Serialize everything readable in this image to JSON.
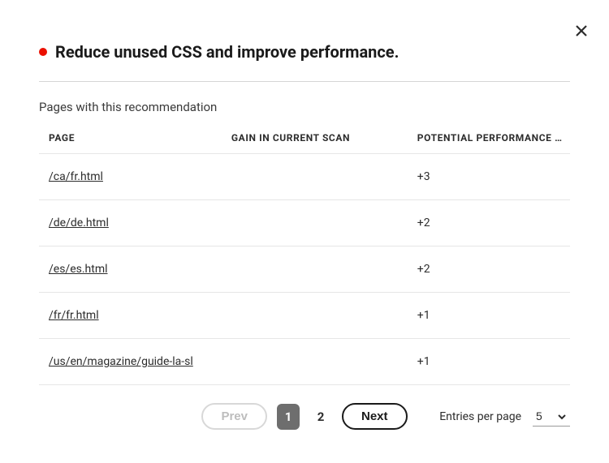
{
  "header": {
    "title": "Reduce unused CSS and improve performance.",
    "status_color": "#eb1000"
  },
  "subtitle": "Pages with this recommendation",
  "table": {
    "headers": {
      "page": "PAGE",
      "gain": "GAIN IN CURRENT SCAN",
      "potential": "POTENTIAL PERFORMANCE …"
    },
    "rows": [
      {
        "page": "/ca/fr.html",
        "gain": "",
        "potential": "+3"
      },
      {
        "page": "/de/de.html",
        "gain": "",
        "potential": "+2"
      },
      {
        "page": "/es/es.html",
        "gain": "",
        "potential": "+2"
      },
      {
        "page": "/fr/fr.html",
        "gain": "",
        "potential": "+1"
      },
      {
        "page": "/us/en/magazine/guide-la-sl",
        "gain": "",
        "potential": "+1"
      }
    ]
  },
  "pagination": {
    "prev": "Prev",
    "next": "Next",
    "pages": [
      "1",
      "2"
    ],
    "active_index": 0
  },
  "entries": {
    "label": "Entries per page",
    "value": "5"
  }
}
